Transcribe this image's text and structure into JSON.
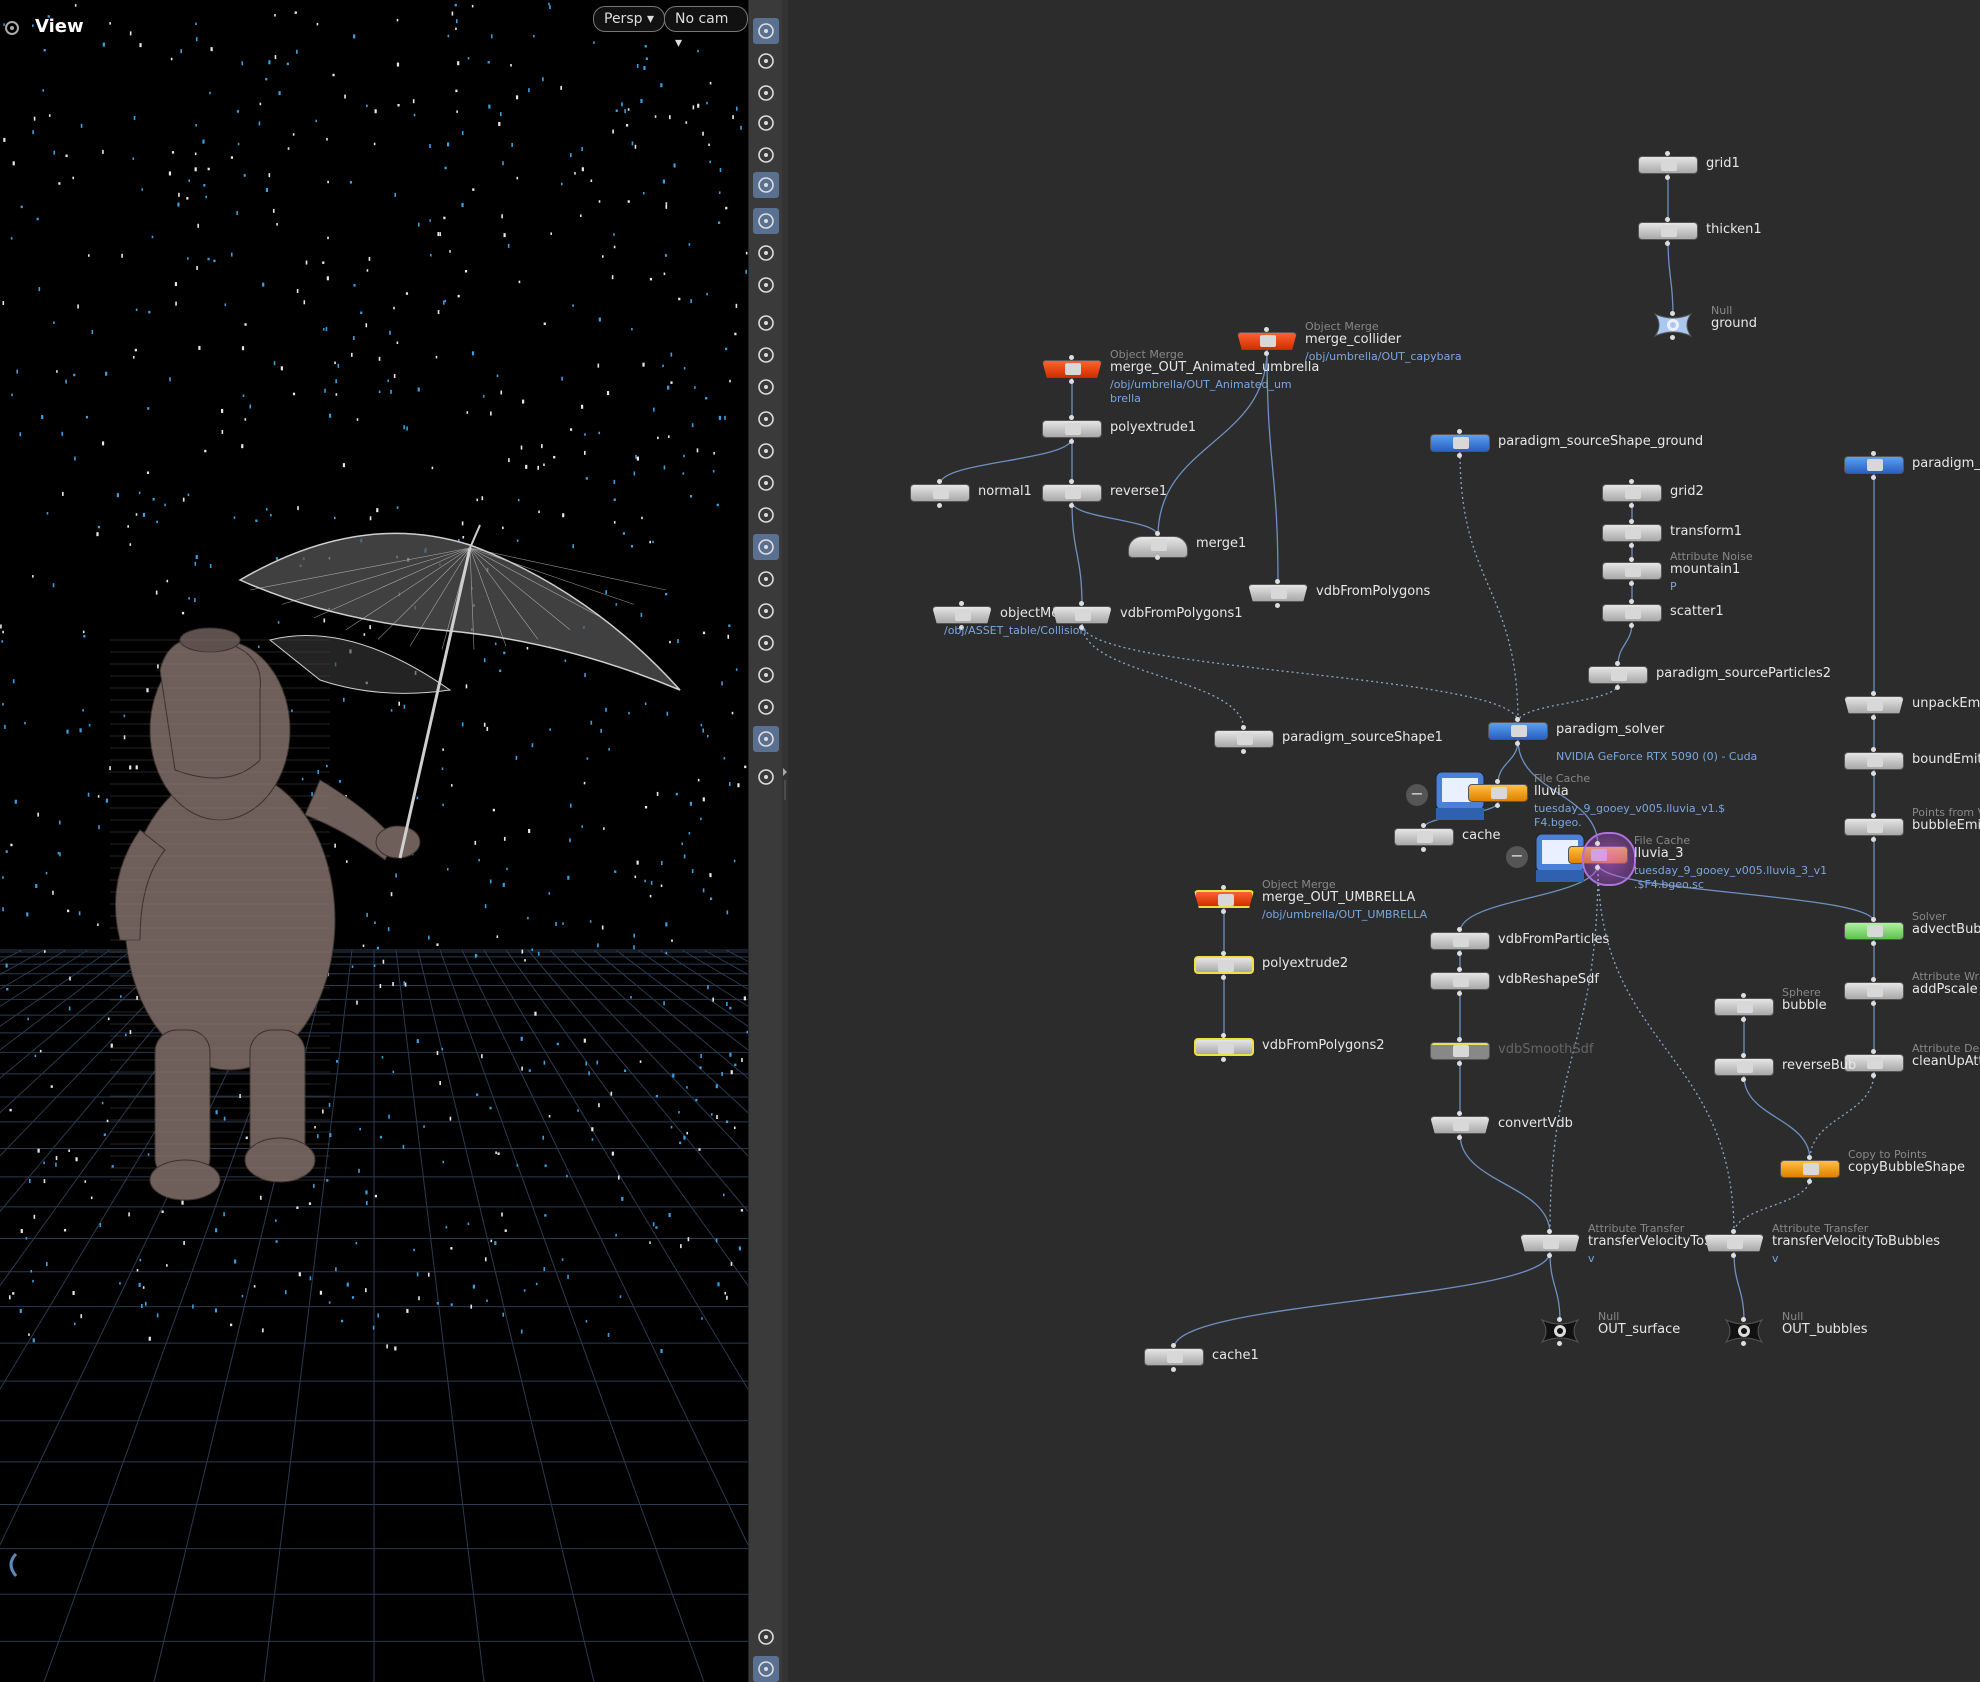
{
  "viewport": {
    "title": "View",
    "persp_label": "Persp",
    "cam_label": "No cam"
  },
  "toolbar": {
    "tools": [
      "ghost-icon",
      "visibility-icon",
      "lock-icon",
      "light-off-icon",
      "light-icon",
      "bulb-icon",
      "camera-icon",
      "display-eye-icon",
      "camera-eye-icon",
      "point-icon",
      "brush-icon",
      "pen-icon",
      "number-12-icon",
      "eraser-icon",
      "number-12b-icon",
      "angle-icon",
      "plane-icon",
      "checker-icon",
      "snap-icon",
      "gift-icon",
      "axis-icon",
      "grid-icon",
      "image-icon",
      "pin-icon",
      "info-icon",
      "layout-icon"
    ]
  },
  "network": {
    "nodes": [
      {
        "id": "grid1",
        "label": "grid1"
      },
      {
        "id": "thicken1",
        "label": "thicken1"
      },
      {
        "id": "ground",
        "label": "ground",
        "type": "Null"
      },
      {
        "id": "merge_collider",
        "label": "merge_collider",
        "type": "Object Merge",
        "path": "/obj/umbrella/OUT_capybara"
      },
      {
        "id": "merge_OUT_Animated_umbrella",
        "label": "merge_OUT_Animated_umbrella",
        "type": "Object Merge",
        "path": "/obj/umbrella/OUT_Animated_um",
        "path2": "brella"
      },
      {
        "id": "polyextrude1",
        "label": "polyextrude1"
      },
      {
        "id": "normal1",
        "label": "normal1"
      },
      {
        "id": "reverse1",
        "label": "reverse1"
      },
      {
        "id": "merge1",
        "label": "merge1"
      },
      {
        "id": "vdbFromPolygons",
        "label": "vdbFromPolygons"
      },
      {
        "id": "objectMerge",
        "label": "objectMer",
        "path": "/obj/ASSET_table/Collision"
      },
      {
        "id": "vdbFromPolygons1",
        "label": "vdbFromPolygons1"
      },
      {
        "id": "paradigm_sourceShape_ground",
        "label": "paradigm_sourceShape_ground"
      },
      {
        "id": "grid2",
        "label": "grid2"
      },
      {
        "id": "transform1",
        "label": "transform1"
      },
      {
        "id": "mountain1",
        "label": "mountain1",
        "type": "Attribute Noise",
        "sub": "P"
      },
      {
        "id": "scatter1",
        "label": "scatter1"
      },
      {
        "id": "paradigm_sourceParticles2",
        "label": "paradigm_sourceParticles2"
      },
      {
        "id": "paradigm_solver",
        "label": "paradigm_solver",
        "path": "NVIDIA GeForce RTX 5090 (0) - Cuda"
      },
      {
        "id": "paradigm_sourceShape1",
        "label": "paradigm_sourceShape1"
      },
      {
        "id": "lluvia",
        "label": "lluvia",
        "type": "File Cache",
        "path": "tuesday_9_gooey_v005.lluvia_v1.$",
        "path2": "F4.bgeo."
      },
      {
        "id": "cache",
        "label": "cache"
      },
      {
        "id": "lluvia_3",
        "label": "lluvia_3",
        "type": "File Cache",
        "path": "tuesday_9_gooey_v005.lluvia_3_v1",
        "path2": ".$F4.bgeo.sc"
      },
      {
        "id": "paradigm_so",
        "label": "paradigm_so"
      },
      {
        "id": "unpackEmitt",
        "label": "unpackEmitt"
      },
      {
        "id": "boundEmitte",
        "label": "boundEmitte"
      },
      {
        "id": "bubbleEmitte",
        "label": "bubbleEmitte",
        "type": "Points from Vo"
      },
      {
        "id": "advectBubbl",
        "label": "advectBubbl",
        "type": "Solver"
      },
      {
        "id": "addPscale",
        "label": "addPscale",
        "type": "Attribute Wra"
      },
      {
        "id": "cleanUpAttri",
        "label": "cleanUpAttri",
        "type": "Attribute Dele"
      },
      {
        "id": "bubble",
        "label": "bubble",
        "type": "Sphere"
      },
      {
        "id": "reverseBub",
        "label": "reverseBub"
      },
      {
        "id": "copyBubbleShape",
        "label": "copyBubbleShape",
        "type": "Copy to Points"
      },
      {
        "id": "merge_OUT_UMBRELLA",
        "label": "merge_OUT_UMBRELLA",
        "type": "Object Merge",
        "path": "/obj/umbrella/OUT_UMBRELLA"
      },
      {
        "id": "polyextrude2",
        "label": "polyextrude2"
      },
      {
        "id": "vdbFromPolygons2",
        "label": "vdbFromPolygons2"
      },
      {
        "id": "vdbFromParticles",
        "label": "vdbFromParticles"
      },
      {
        "id": "vdbReshapeSdf",
        "label": "vdbReshapeSdf"
      },
      {
        "id": "vdbSmoothSdf",
        "label": "vdbSmoothSdf"
      },
      {
        "id": "convertVdb",
        "label": "convertVdb"
      },
      {
        "id": "transferVelocityToSu",
        "label": "transferVelocityToSu",
        "type": "Attribute Transfer",
        "sub": "v"
      },
      {
        "id": "transferVelocityToBubbles",
        "label": "transferVelocityToBubbles",
        "type": "Attribute Transfer",
        "sub": "v"
      },
      {
        "id": "OUT_surface",
        "label": "OUT_surface",
        "type": "Null"
      },
      {
        "id": "OUT_bubbles",
        "label": "OUT_bubbles",
        "type": "Null"
      },
      {
        "id": "cache1",
        "label": "cache1"
      }
    ]
  },
  "colors": {
    "viewport_bg": "#000000",
    "network_bg": "#2c2c2c",
    "particle_blue": "#3aa0e0",
    "node_red": "#e84010",
    "node_blue": "#3a80e0",
    "node_yellow": "#f0e040",
    "node_orange": "#f0a020",
    "node_green": "#90e080",
    "path_text": "#7aa6e0"
  }
}
